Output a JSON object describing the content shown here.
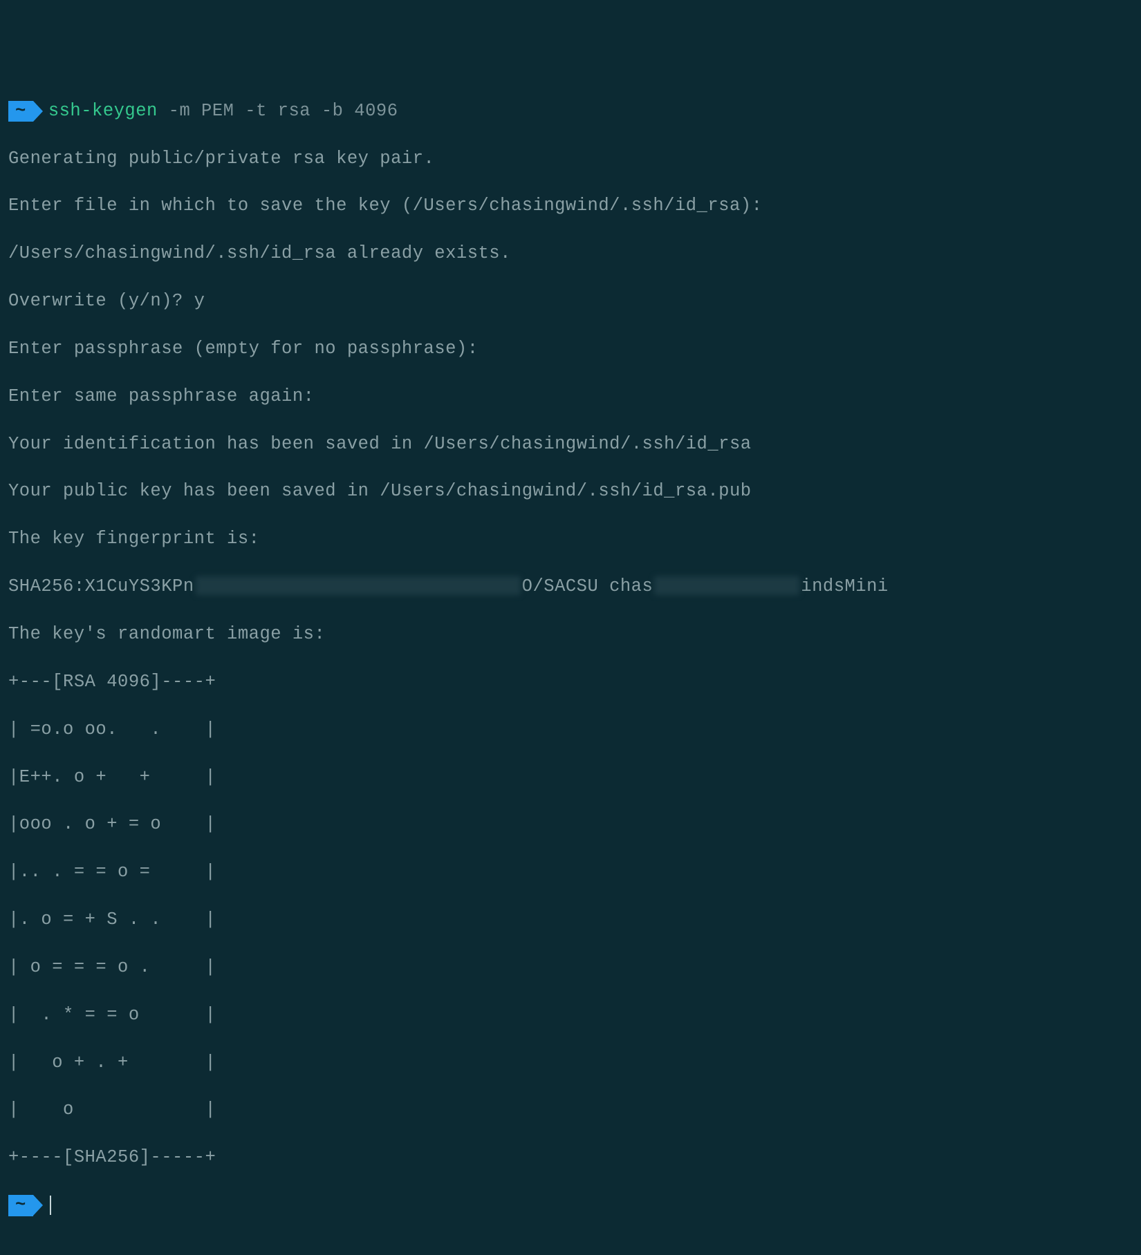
{
  "prompt": {
    "cwd_symbol": "~",
    "command": "ssh-keygen",
    "args": " -m PEM -t rsa -b 4096"
  },
  "output": {
    "l1": "Generating public/private rsa key pair.",
    "l2": "Enter file in which to save the key (/Users/chasingwind/.ssh/id_rsa):",
    "l3": "/Users/chasingwind/.ssh/id_rsa already exists.",
    "l4": "Overwrite (y/n)? y",
    "l5": "Enter passphrase (empty for no passphrase):",
    "l6": "Enter same passphrase again:",
    "l7": "Your identification has been saved in /Users/chasingwind/.ssh/id_rsa",
    "l8": "Your public key has been saved in /Users/chasingwind/.ssh/id_rsa.pub",
    "l9": "The key fingerprint is:",
    "fp_a": "SHA256:X1CuYS3KPn",
    "fp_b": "O/SACSU chas",
    "fp_c": "indsMini",
    "l10": "The key's randomart image is:",
    "art": [
      "+---[RSA 4096]----+",
      "| =o.o oo.   .    |",
      "|E++. o +   +     |",
      "|ooo . o + = o    |",
      "|.. . = = o =     |",
      "|. o = + S . .    |",
      "| o = = = o .     |",
      "|  . * = = o      |",
      "|   o + . +       |",
      "|    o            |",
      "+----[SHA256]-----+"
    ]
  },
  "prompt2": {
    "cwd_symbol": "~"
  }
}
